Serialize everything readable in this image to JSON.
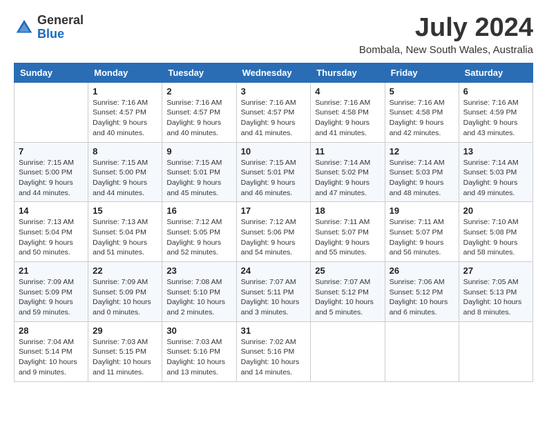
{
  "header": {
    "logo_general": "General",
    "logo_blue": "Blue",
    "month_title": "July 2024",
    "location": "Bombala, New South Wales, Australia"
  },
  "days_of_week": [
    "Sunday",
    "Monday",
    "Tuesday",
    "Wednesday",
    "Thursday",
    "Friday",
    "Saturday"
  ],
  "weeks": [
    [
      {
        "day": "",
        "info": ""
      },
      {
        "day": "1",
        "info": "Sunrise: 7:16 AM\nSunset: 4:57 PM\nDaylight: 9 hours\nand 40 minutes."
      },
      {
        "day": "2",
        "info": "Sunrise: 7:16 AM\nSunset: 4:57 PM\nDaylight: 9 hours\nand 40 minutes."
      },
      {
        "day": "3",
        "info": "Sunrise: 7:16 AM\nSunset: 4:57 PM\nDaylight: 9 hours\nand 41 minutes."
      },
      {
        "day": "4",
        "info": "Sunrise: 7:16 AM\nSunset: 4:58 PM\nDaylight: 9 hours\nand 41 minutes."
      },
      {
        "day": "5",
        "info": "Sunrise: 7:16 AM\nSunset: 4:58 PM\nDaylight: 9 hours\nand 42 minutes."
      },
      {
        "day": "6",
        "info": "Sunrise: 7:16 AM\nSunset: 4:59 PM\nDaylight: 9 hours\nand 43 minutes."
      }
    ],
    [
      {
        "day": "7",
        "info": "Sunrise: 7:15 AM\nSunset: 5:00 PM\nDaylight: 9 hours\nand 44 minutes."
      },
      {
        "day": "8",
        "info": "Sunrise: 7:15 AM\nSunset: 5:00 PM\nDaylight: 9 hours\nand 44 minutes."
      },
      {
        "day": "9",
        "info": "Sunrise: 7:15 AM\nSunset: 5:01 PM\nDaylight: 9 hours\nand 45 minutes."
      },
      {
        "day": "10",
        "info": "Sunrise: 7:15 AM\nSunset: 5:01 PM\nDaylight: 9 hours\nand 46 minutes."
      },
      {
        "day": "11",
        "info": "Sunrise: 7:14 AM\nSunset: 5:02 PM\nDaylight: 9 hours\nand 47 minutes."
      },
      {
        "day": "12",
        "info": "Sunrise: 7:14 AM\nSunset: 5:03 PM\nDaylight: 9 hours\nand 48 minutes."
      },
      {
        "day": "13",
        "info": "Sunrise: 7:14 AM\nSunset: 5:03 PM\nDaylight: 9 hours\nand 49 minutes."
      }
    ],
    [
      {
        "day": "14",
        "info": "Sunrise: 7:13 AM\nSunset: 5:04 PM\nDaylight: 9 hours\nand 50 minutes."
      },
      {
        "day": "15",
        "info": "Sunrise: 7:13 AM\nSunset: 5:04 PM\nDaylight: 9 hours\nand 51 minutes."
      },
      {
        "day": "16",
        "info": "Sunrise: 7:12 AM\nSunset: 5:05 PM\nDaylight: 9 hours\nand 52 minutes."
      },
      {
        "day": "17",
        "info": "Sunrise: 7:12 AM\nSunset: 5:06 PM\nDaylight: 9 hours\nand 54 minutes."
      },
      {
        "day": "18",
        "info": "Sunrise: 7:11 AM\nSunset: 5:07 PM\nDaylight: 9 hours\nand 55 minutes."
      },
      {
        "day": "19",
        "info": "Sunrise: 7:11 AM\nSunset: 5:07 PM\nDaylight: 9 hours\nand 56 minutes."
      },
      {
        "day": "20",
        "info": "Sunrise: 7:10 AM\nSunset: 5:08 PM\nDaylight: 9 hours\nand 58 minutes."
      }
    ],
    [
      {
        "day": "21",
        "info": "Sunrise: 7:09 AM\nSunset: 5:09 PM\nDaylight: 9 hours\nand 59 minutes."
      },
      {
        "day": "22",
        "info": "Sunrise: 7:09 AM\nSunset: 5:09 PM\nDaylight: 10 hours\nand 0 minutes."
      },
      {
        "day": "23",
        "info": "Sunrise: 7:08 AM\nSunset: 5:10 PM\nDaylight: 10 hours\nand 2 minutes."
      },
      {
        "day": "24",
        "info": "Sunrise: 7:07 AM\nSunset: 5:11 PM\nDaylight: 10 hours\nand 3 minutes."
      },
      {
        "day": "25",
        "info": "Sunrise: 7:07 AM\nSunset: 5:12 PM\nDaylight: 10 hours\nand 5 minutes."
      },
      {
        "day": "26",
        "info": "Sunrise: 7:06 AM\nSunset: 5:12 PM\nDaylight: 10 hours\nand 6 minutes."
      },
      {
        "day": "27",
        "info": "Sunrise: 7:05 AM\nSunset: 5:13 PM\nDaylight: 10 hours\nand 8 minutes."
      }
    ],
    [
      {
        "day": "28",
        "info": "Sunrise: 7:04 AM\nSunset: 5:14 PM\nDaylight: 10 hours\nand 9 minutes."
      },
      {
        "day": "29",
        "info": "Sunrise: 7:03 AM\nSunset: 5:15 PM\nDaylight: 10 hours\nand 11 minutes."
      },
      {
        "day": "30",
        "info": "Sunrise: 7:03 AM\nSunset: 5:16 PM\nDaylight: 10 hours\nand 13 minutes."
      },
      {
        "day": "31",
        "info": "Sunrise: 7:02 AM\nSunset: 5:16 PM\nDaylight: 10 hours\nand 14 minutes."
      },
      {
        "day": "",
        "info": ""
      },
      {
        "day": "",
        "info": ""
      },
      {
        "day": "",
        "info": ""
      }
    ]
  ]
}
